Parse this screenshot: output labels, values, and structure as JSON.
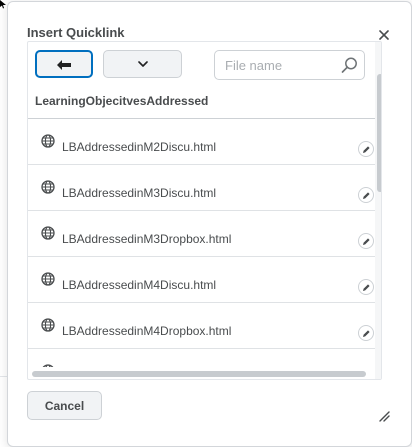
{
  "dialog": {
    "title": "Insert Quicklink",
    "close_icon": "close-icon"
  },
  "toolbar": {
    "back_icon": "arrow-left-icon",
    "dropdown_icon": "chevron-down-icon",
    "search": {
      "placeholder": "File name",
      "value": "",
      "icon": "search-icon"
    }
  },
  "folder": {
    "name": "LearningObjecitvesAddressed"
  },
  "files": [
    {
      "name": "LBAddressedinM2Discu.html",
      "icon": "globe-icon",
      "action_icon": "pencil-icon"
    },
    {
      "name": "LBAddressedinM3Discu.html",
      "icon": "globe-icon",
      "action_icon": "pencil-icon"
    },
    {
      "name": "LBAddressedinM3Dropbox.html",
      "icon": "globe-icon",
      "action_icon": "pencil-icon"
    },
    {
      "name": "LBAddressedinM4Discu.html",
      "icon": "globe-icon",
      "action_icon": "pencil-icon"
    },
    {
      "name": "LBAddressedinM4Dropbox.html",
      "icon": "globe-icon",
      "action_icon": "pencil-icon"
    },
    {
      "name": "",
      "icon": "globe-icon",
      "action_icon": "pencil-icon"
    }
  ],
  "footer": {
    "cancel_label": "Cancel",
    "resize_icon": "resize-handle-icon"
  },
  "colors": {
    "focus_blue": "#006fbf",
    "text": "#494c4e",
    "border": "#cdd1d5"
  }
}
